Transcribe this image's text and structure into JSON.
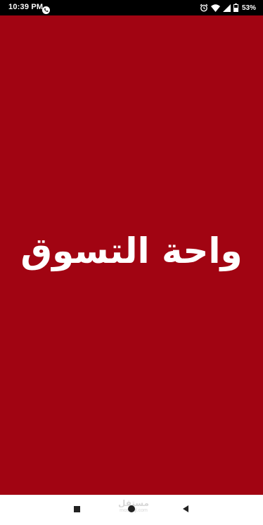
{
  "status_bar": {
    "time": "10:39 PM",
    "battery_percent": "53%",
    "icons": [
      "call-icon",
      "alarm-icon",
      "wifi-icon",
      "signal-icon",
      "battery-icon"
    ]
  },
  "splash": {
    "title": "واحة التسوق",
    "background_color": "#a10412",
    "text_color": "#ffffff"
  },
  "watermark": {
    "arabic": "مستقل",
    "latin": "mostaql.com"
  },
  "nav_bar": {
    "icons": [
      "recents-icon",
      "home-icon",
      "back-icon"
    ]
  }
}
